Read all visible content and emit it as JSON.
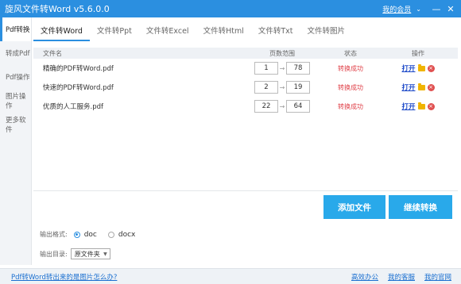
{
  "window": {
    "title": "旋风文件转Word v5.6.0.0",
    "member_link": "我的会员",
    "chevron": "⌄",
    "minimize": "—",
    "close": "✕"
  },
  "sidebar": {
    "items": [
      {
        "label": "Pdf转换",
        "active": true
      },
      {
        "label": "转成Pdf"
      },
      {
        "label": "Pdf操作"
      },
      {
        "label": "图片操作"
      },
      {
        "label": "更多软件"
      }
    ]
  },
  "tabs": [
    "文件转Word",
    "文件转Ppt",
    "文件转Excel",
    "文件转Html",
    "文件转Txt",
    "文件转图片"
  ],
  "table": {
    "headers": {
      "name": "文件名",
      "range": "页数范围",
      "status": "状态",
      "action": "操作"
    },
    "rows": [
      {
        "name": "精确的PDF转Word.pdf",
        "from": "1",
        "to": "78",
        "status": "转换成功",
        "open": "打开"
      },
      {
        "name": "快速的PDF转Word.pdf",
        "from": "2",
        "to": "19",
        "status": "转换成功",
        "open": "打开"
      },
      {
        "name": "优质的人工服务.pdf",
        "from": "22",
        "to": "64",
        "status": "转换成功",
        "open": "打开"
      }
    ]
  },
  "buttons": {
    "add": "添加文件",
    "continue": "继续转换"
  },
  "output_format": {
    "label": "输出格式:",
    "opt1": "doc",
    "opt2": "docx",
    "selected": "doc"
  },
  "output_dir": {
    "label": "输出目录:",
    "value": "原文件夹"
  },
  "footer": {
    "question": "Pdf转Word转出来的是图片怎么办?",
    "link1": "高效办公",
    "link2": "我的客服",
    "link3": "我的官网"
  },
  "colors": {
    "accent": "#2b8fe0",
    "button": "#29a9ea",
    "status": "#e0424a"
  }
}
